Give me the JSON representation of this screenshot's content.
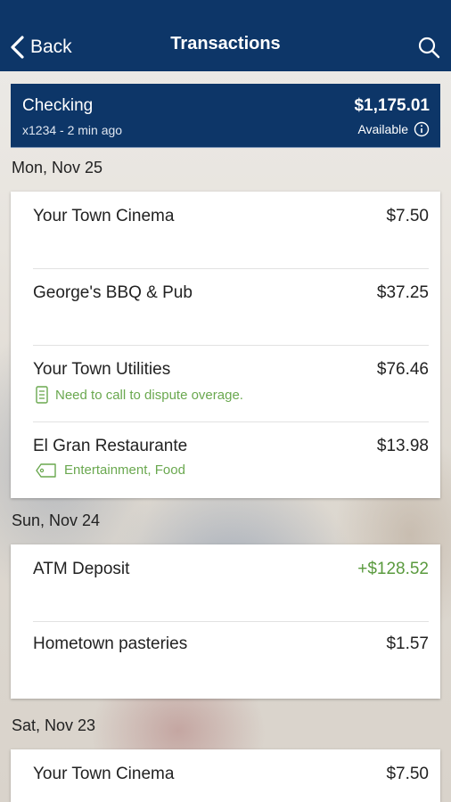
{
  "header": {
    "back_label": "Back",
    "title": "Transactions"
  },
  "account": {
    "name": "Checking",
    "subtitle": "x1234 - 2 min ago",
    "balance": "$1,175.01",
    "available_label": "Available"
  },
  "groups": [
    {
      "date": "Mon, Nov 25",
      "transactions": [
        {
          "name": "Your Town Cinema",
          "amount": "$7.50"
        },
        {
          "name": "George's BBQ & Pub",
          "amount": "$37.25"
        },
        {
          "name": "Your Town Utilities",
          "amount": "$76.46",
          "note": "Need to call to dispute overage.",
          "note_icon": "memo-icon"
        },
        {
          "name": "El Gran Restaurante",
          "amount": "$13.98",
          "note": "Entertainment, Food",
          "note_icon": "tag-icon"
        }
      ]
    },
    {
      "date": "Sun, Nov 24",
      "transactions": [
        {
          "name": "ATM Deposit",
          "amount": "+$128.52"
        },
        {
          "name": "Hometown pasteries",
          "amount": "$1.57"
        }
      ]
    },
    {
      "date": "Sat, Nov 23",
      "transactions": [
        {
          "name": "Your Town Cinema",
          "amount": "$7.50"
        }
      ]
    }
  ],
  "colors": {
    "navy": "#0d3668",
    "positive": "#5a9a3e",
    "note": "#6aa84f"
  }
}
